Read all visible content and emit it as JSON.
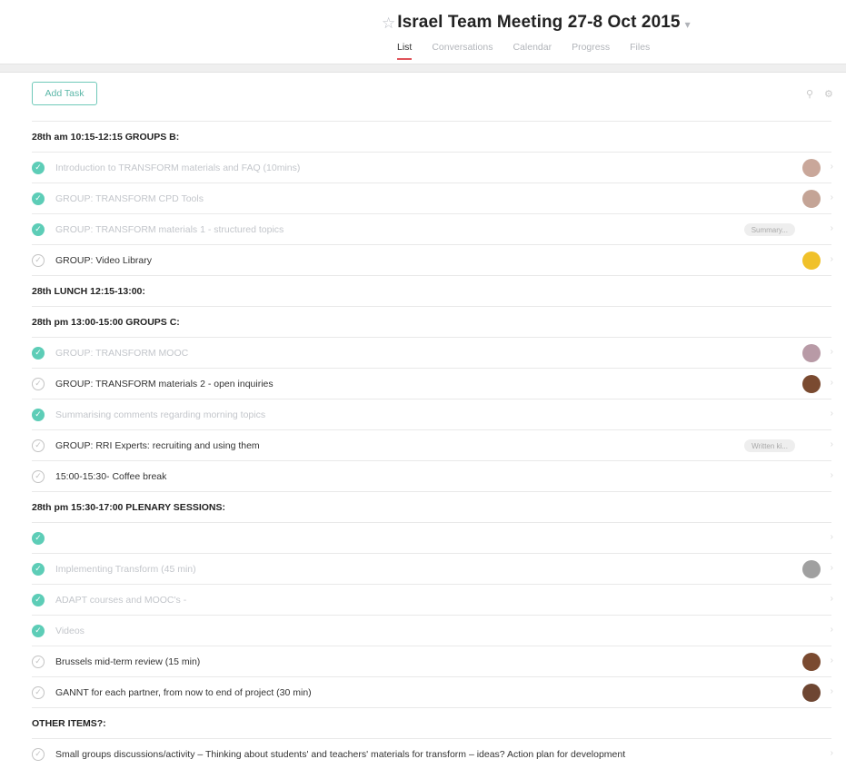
{
  "project": {
    "title": "Israel Team Meeting 27-8 Oct 2015"
  },
  "tabs": [
    {
      "label": "List",
      "active": true
    },
    {
      "label": "Conversations"
    },
    {
      "label": "Calendar"
    },
    {
      "label": "Progress"
    },
    {
      "label": "Files"
    }
  ],
  "toolbar": {
    "add_task_label": "Add Task",
    "icons": [
      "person-icon",
      "gear-icon"
    ]
  },
  "colors": {
    "accent": "#5dcdb7",
    "active_tab": "#e0535a"
  },
  "rows": [
    {
      "type": "section",
      "label": "28th am 10:15-12:15 GROUPS B:"
    },
    {
      "type": "task",
      "label": "Introduction to TRANSFORM materials and FAQ (10mins)",
      "completed": true,
      "avatar": "#c9a79a"
    },
    {
      "type": "task",
      "label": "GROUP: TRANSFORM CPD Tools",
      "completed": true,
      "avatar": "#c4a496"
    },
    {
      "type": "task",
      "label": "GROUP: TRANSFORM materials 1 - structured topics",
      "completed": true,
      "tag": "Summary..."
    },
    {
      "type": "task",
      "label": "GROUP: Video Library",
      "completed": false,
      "avatar": "#f0c12a"
    },
    {
      "type": "section",
      "label": "28th LUNCH 12:15-13:00:"
    },
    {
      "type": "section",
      "label": "28th pm 13:00-15:00 GROUPS  C:"
    },
    {
      "type": "task",
      "label": "GROUP: TRANSFORM MOOC",
      "completed": true,
      "avatar": "#b89aa6"
    },
    {
      "type": "task",
      "label": "GROUP: TRANSFORM materials 2 - open  inquiries",
      "completed": false,
      "avatar": "#7a4a30"
    },
    {
      "type": "task",
      "label": "Summarising comments regarding morning topics",
      "completed": true
    },
    {
      "type": "task",
      "label": "GROUP: RRI Experts: recruiting and using them",
      "completed": false,
      "tag": "Written ki..."
    },
    {
      "type": "task",
      "label": "15:00-15:30- Coffee break",
      "completed": false
    },
    {
      "type": "section",
      "label": "28th pm 15:30-17:00 PLENARY SESSIONS:"
    },
    {
      "type": "task",
      "label": "",
      "completed": true
    },
    {
      "type": "task",
      "label": "Implementing Transform (45         min)",
      "completed": true,
      "avatar": "#a0a0a0"
    },
    {
      "type": "task",
      "label": "ADAPT courses and MOOC's -",
      "completed": true
    },
    {
      "type": "task",
      "label": "Videos",
      "completed": true
    },
    {
      "type": "task",
      "label": "Brussels mid-term review  (15 min)",
      "completed": false,
      "avatar": "#7a4a30"
    },
    {
      "type": "task",
      "label": "GANNT for each partner, from now to end of project (30 min)",
      "completed": false,
      "avatar": "#6e4632"
    },
    {
      "type": "section",
      "label": "OTHER ITEMS?:"
    },
    {
      "type": "task",
      "label": "Small groups discussions/activity  – Thinking about students' and teachers' materials for transform – ideas? Action plan for development",
      "completed": false
    }
  ]
}
